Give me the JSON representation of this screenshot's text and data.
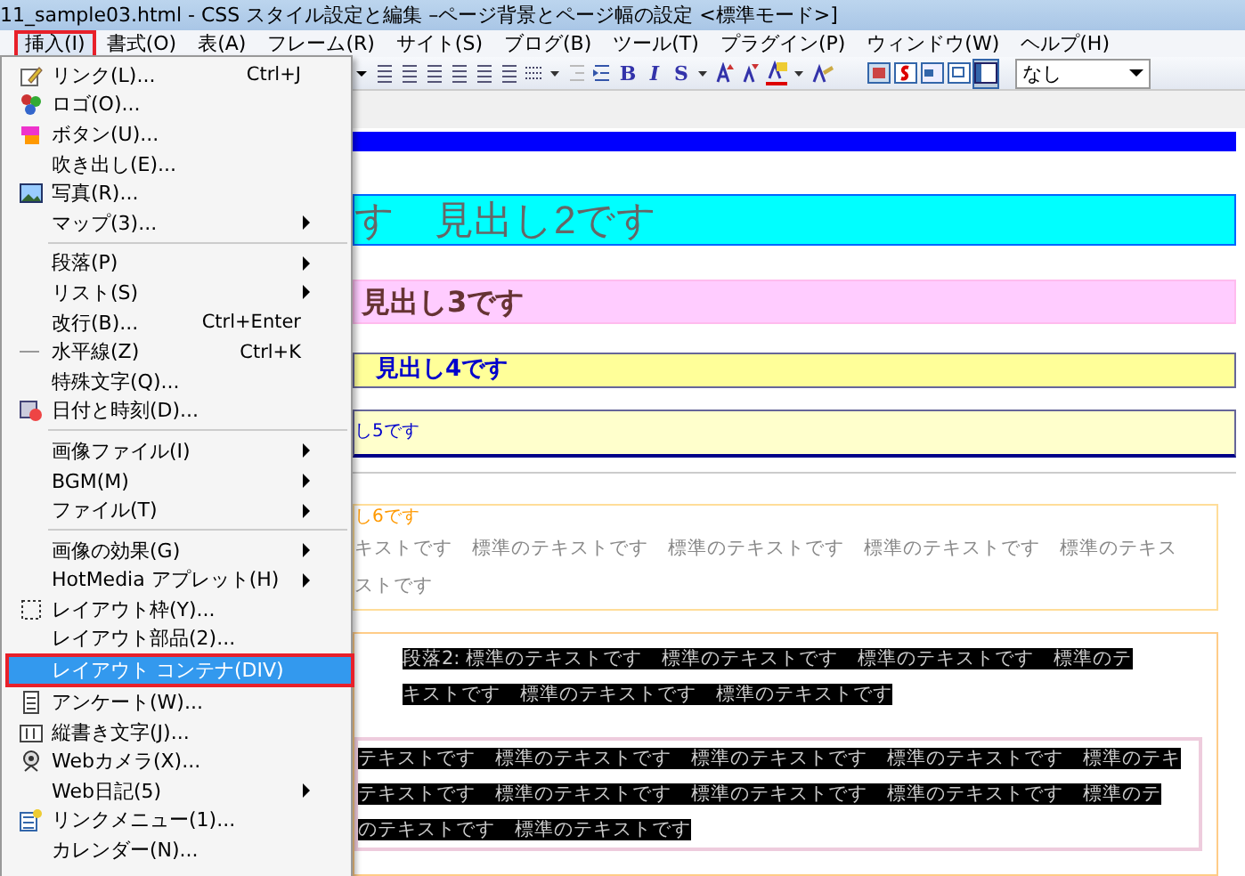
{
  "window": {
    "title": "11_sample03.html - CSS スタイル設定と編集 –ページ背景とページ幅の設定 <標準モード>]"
  },
  "menubar": [
    {
      "label": "挿入(I)",
      "selected": true
    },
    {
      "label": "書式(O)",
      "selected": false
    },
    {
      "label": "表(A)",
      "selected": false
    },
    {
      "label": "フレーム(R)",
      "selected": false
    },
    {
      "label": "サイト(S)",
      "selected": false
    },
    {
      "label": "ブログ(B)",
      "selected": false
    },
    {
      "label": "ツール(T)",
      "selected": false
    },
    {
      "label": "プラグイン(P)",
      "selected": false
    },
    {
      "label": "ウィンドウ(W)",
      "selected": false
    },
    {
      "label": "ヘルプ(H)",
      "selected": false
    }
  ],
  "toolbar": {
    "bold": "B",
    "italic": "I",
    "strike": "S",
    "style_select": "なし"
  },
  "insert_menu": [
    [
      {
        "label": "リンク(L)...",
        "shortcut": "Ctrl+J",
        "kind": "pencil",
        "submenu": false,
        "selected": false
      },
      {
        "label": "ロゴ(O)...",
        "kind": "dots",
        "submenu": false,
        "selected": false
      },
      {
        "label": "ボタン(U)...",
        "kind": "button",
        "submenu": false,
        "selected": false
      },
      {
        "label": "吹き出し(E)...",
        "submenu": false,
        "selected": false
      },
      {
        "label": "写真(R)...",
        "kind": "photo",
        "submenu": false,
        "selected": false
      },
      {
        "label": "マップ(3)...",
        "submenu": true,
        "selected": false
      }
    ],
    [
      {
        "label": "段落(P)",
        "submenu": true,
        "selected": false
      },
      {
        "label": "リスト(S)",
        "submenu": true,
        "selected": false
      },
      {
        "label": "改行(B)...",
        "shortcut": "Ctrl+Enter",
        "submenu": false,
        "selected": false
      },
      {
        "label": "水平線(Z)",
        "shortcut": "Ctrl+K",
        "kind": "dash",
        "submenu": false,
        "selected": false
      },
      {
        "label": "特殊文字(Q)...",
        "submenu": false,
        "selected": false
      },
      {
        "label": "日付と時刻(D)...",
        "kind": "calendar",
        "submenu": false,
        "selected": false
      }
    ],
    [
      {
        "label": "画像ファイル(I)",
        "submenu": true,
        "selected": false
      },
      {
        "label": "BGM(M)",
        "submenu": true,
        "selected": false
      },
      {
        "label": "ファイル(T)",
        "submenu": true,
        "selected": false
      }
    ],
    [
      {
        "label": "画像の効果(G)",
        "submenu": true,
        "selected": false
      },
      {
        "label": "HotMedia アプレット(H)",
        "submenu": true,
        "selected": false
      },
      {
        "label": "レイアウト枠(Y)...",
        "kind": "dotted",
        "submenu": false,
        "selected": false
      },
      {
        "label": "レイアウト部品(2)...",
        "submenu": false,
        "selected": false
      },
      {
        "label": "レイアウト コンテナ(DIV)",
        "submenu": false,
        "selected": true
      },
      {
        "label": "アンケート(W)...",
        "kind": "form",
        "submenu": false,
        "selected": false
      },
      {
        "label": "縦書き文字(J)...",
        "kind": "vertical",
        "submenu": false,
        "selected": false
      },
      {
        "label": "Webカメラ(X)...",
        "kind": "camera",
        "submenu": false,
        "selected": false
      },
      {
        "label": "Web日記(5)",
        "submenu": true,
        "selected": false
      },
      {
        "label": "リンクメニュー(1)...",
        "kind": "list",
        "submenu": false,
        "selected": false
      },
      {
        "label": "カレンダー(N)...",
        "submenu": false,
        "selected": false
      }
    ]
  ],
  "editor": {
    "heading2": "す　見出し2です",
    "heading3": "見出し3です",
    "heading4": "見出し4です",
    "heading5": "し5です",
    "box1": {
      "heading6": "し6です",
      "text": [
        "キストです　標準のテキストです　標準のテキストです　標準のテキストです　標準のテキス",
        "ストです"
      ]
    },
    "box2": {
      "paragraph": [
        "段落2:  標準のテキストです　標準のテキストです　標準のテキストです　標準のテ",
        "キストです　標準のテキストです　標準のテキストです"
      ],
      "inner": [
        "テキストです　標準のテキストです　標準のテキストです　標準のテキストです　標準のテキ",
        "テキストです　標準のテキストです　標準のテキストです　標準のテキストです　標準のテ",
        "のテキストです　標準のテキストです"
      ]
    }
  }
}
